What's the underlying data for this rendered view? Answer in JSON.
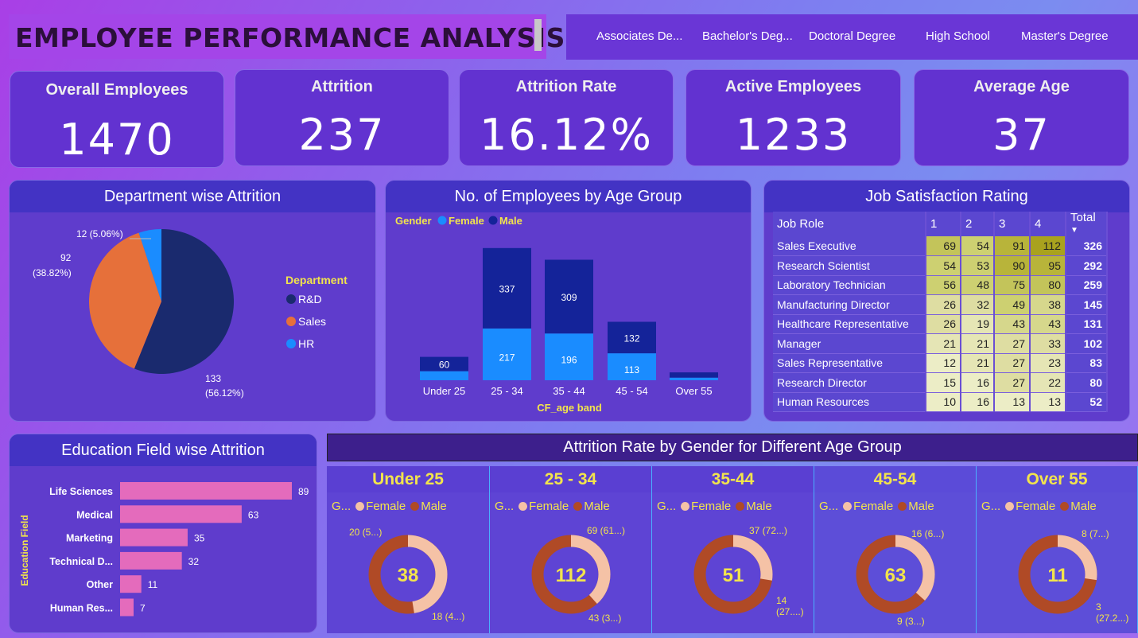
{
  "title": "EMPLOYEE PERFORMANCE ANALYSIS",
  "education_slicer": [
    "Associates De...",
    "Bachelor's Deg...",
    "Doctoral Degree",
    "High School",
    "Master's Degree"
  ],
  "kpis": [
    {
      "label": "Overall Employees",
      "value": "1470"
    },
    {
      "label": "Attrition",
      "value": "237"
    },
    {
      "label": "Attrition Rate",
      "value": "16.12%"
    },
    {
      "label": "Active Employees",
      "value": "1233"
    },
    {
      "label": "Average Age",
      "value": "37"
    }
  ],
  "colors": {
    "rnd": "#1a2a6e",
    "sales": "#e6703a",
    "hr": "#1a8cff",
    "female_bar": "#1a8cff",
    "male_bar": "#142399",
    "female_donut": "#f5c2a6",
    "male_donut": "#b04a26",
    "edu_bar": "#e46bbc",
    "accent": "#f2e44c"
  },
  "chart_data": [
    {
      "type": "pie",
      "title": "Department wise Attrition",
      "legend_title": "Department",
      "legend_position": "right",
      "labels": [
        "R&D",
        "Sales",
        "HR"
      ],
      "values": [
        133,
        92,
        12
      ],
      "value_labels": [
        "133",
        "92",
        "12 (5.06%)"
      ],
      "pct_labels": [
        "(56.12%)",
        "(38.82%)",
        ""
      ]
    },
    {
      "type": "bar",
      "title": "No. of Employees by Age Group",
      "legend_title": "Gender",
      "legend_position": "top-left",
      "xlabel": "CF_age band",
      "categories": [
        "Under 25",
        "25 - 34",
        "35 - 44",
        "45 - 54",
        "Over 55"
      ],
      "series": [
        {
          "name": "Female",
          "values": [
            38,
            217,
            196,
            113,
            11
          ]
        },
        {
          "name": "Male",
          "values": [
            60,
            337,
            309,
            132,
            22
          ]
        }
      ],
      "shown_labels": {
        "Female": [
          "",
          "217",
          "196",
          "113",
          ""
        ],
        "Male": [
          "60",
          "337",
          "309",
          "132",
          ""
        ]
      }
    },
    {
      "type": "table",
      "title": "Job Satisfaction Rating",
      "columns": [
        "Job Role",
        "1",
        "2",
        "3",
        "4",
        "Total"
      ],
      "rows": [
        [
          "Sales Executive",
          69,
          54,
          91,
          112,
          326
        ],
        [
          "Research Scientist",
          54,
          53,
          90,
          95,
          292
        ],
        [
          "Laboratory Technician",
          56,
          48,
          75,
          80,
          259
        ],
        [
          "Manufacturing Director",
          26,
          32,
          49,
          38,
          145
        ],
        [
          "Healthcare Representative",
          26,
          19,
          43,
          43,
          131
        ],
        [
          "Manager",
          21,
          21,
          27,
          33,
          102
        ],
        [
          "Sales Representative",
          12,
          21,
          27,
          23,
          83
        ],
        [
          "Research Director",
          15,
          16,
          27,
          22,
          80
        ],
        [
          "Human Resources",
          10,
          16,
          13,
          13,
          52
        ]
      ]
    },
    {
      "type": "bar",
      "title": "Education Field wise Attrition",
      "ylabel": "Education Field",
      "categories": [
        "Life Sciences",
        "Medical",
        "Marketing",
        "Technical D...",
        "Other",
        "Human Res..."
      ],
      "values": [
        89,
        63,
        35,
        32,
        11,
        7
      ]
    },
    {
      "type": "pie",
      "title": "Attrition Rate by Gender for Different Age Group",
      "panels": [
        {
          "title": "Under 25",
          "legend_title": "G...",
          "center": "38",
          "female_label": "18 (4...)",
          "male_label": "20 (5...)",
          "female": 18,
          "male": 20
        },
        {
          "title": "25 - 34",
          "legend_title": "G...",
          "center": "112",
          "female_label": "43 (3...)",
          "male_label": "69 (61...)",
          "female": 43,
          "male": 69
        },
        {
          "title": "35-44",
          "legend_title": "G...",
          "center": "51",
          "female_label": "14 (27....)",
          "male_label": "37 (72...)",
          "female": 14,
          "male": 37
        },
        {
          "title": "45-54",
          "legend_title": "G...",
          "center": "63",
          "female_label": "9 (3...)",
          "male_label": "16 (6...)",
          "female": 23,
          "male": 40
        },
        {
          "title": "Over 55",
          "legend_title": "G...",
          "center": "11",
          "female_label": "3 (27.2...)",
          "male_label": "8 (7...)",
          "female": 3,
          "male": 8
        }
      ],
      "series_names": [
        "Female",
        "Male"
      ]
    }
  ]
}
